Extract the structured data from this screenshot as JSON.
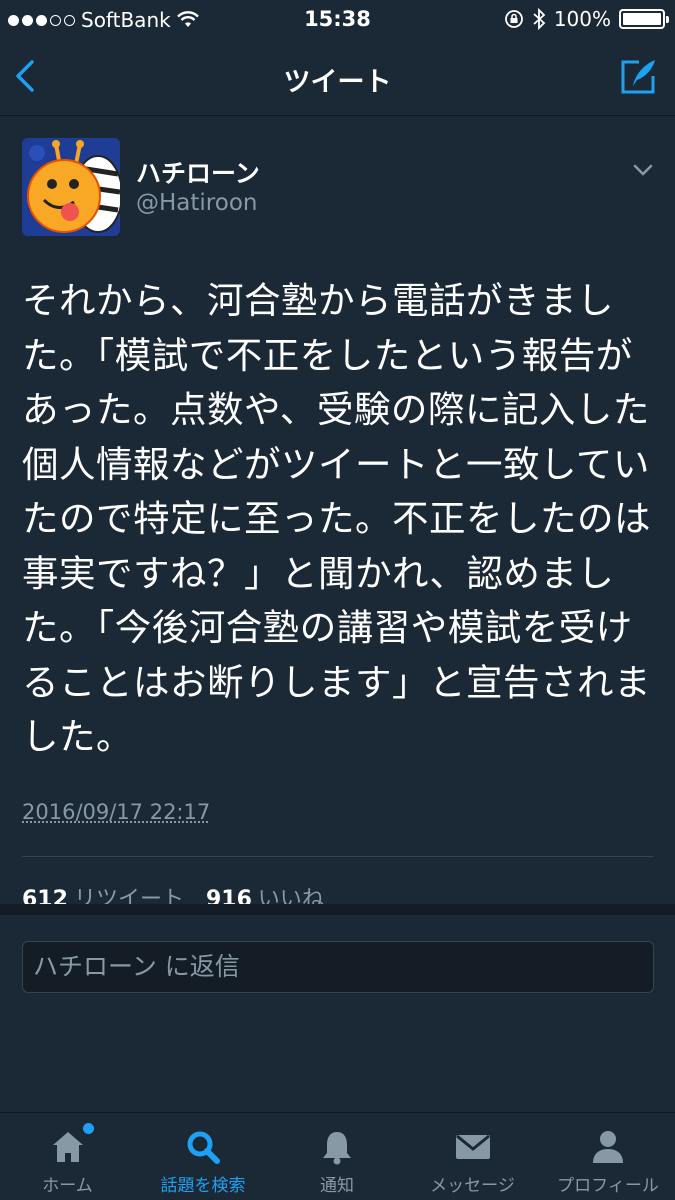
{
  "status_bar": {
    "carrier": "SoftBank",
    "time": "15:38",
    "battery": "100%"
  },
  "nav": {
    "title": "ツイート"
  },
  "tweet": {
    "name": "ハチローン",
    "handle": "@Hatiroon",
    "text": "それから、河合塾から電話がきました。「模試で不正をしたという報告があった。点数や、受験の際に記入した個人情報などがツイートと一致していたので特定に至った。不正をしたのは事実ですね？」と聞かれ、認めました。「今後河合塾の講習や模試を受けることはお断りします」と宣告されました。",
    "timestamp": "2016/09/17 22:17",
    "retweet_count": "612",
    "retweet_label": "リツイート",
    "like_count": "916",
    "like_label": "いいね"
  },
  "reply": {
    "placeholder": "ハチローン に返信"
  },
  "tabs": [
    {
      "label": "ホーム",
      "icon": "home-icon",
      "active": false
    },
    {
      "label": "話題を検索",
      "icon": "search-icon",
      "active": true
    },
    {
      "label": "通知",
      "icon": "bell-icon",
      "active": false
    },
    {
      "label": "メッセージ",
      "icon": "envelope-icon",
      "active": false
    },
    {
      "label": "プロフィール",
      "icon": "person-icon",
      "active": false
    }
  ],
  "colors": {
    "background": "#1b2836",
    "accent": "#1da1f2",
    "muted": "#8899a6"
  }
}
